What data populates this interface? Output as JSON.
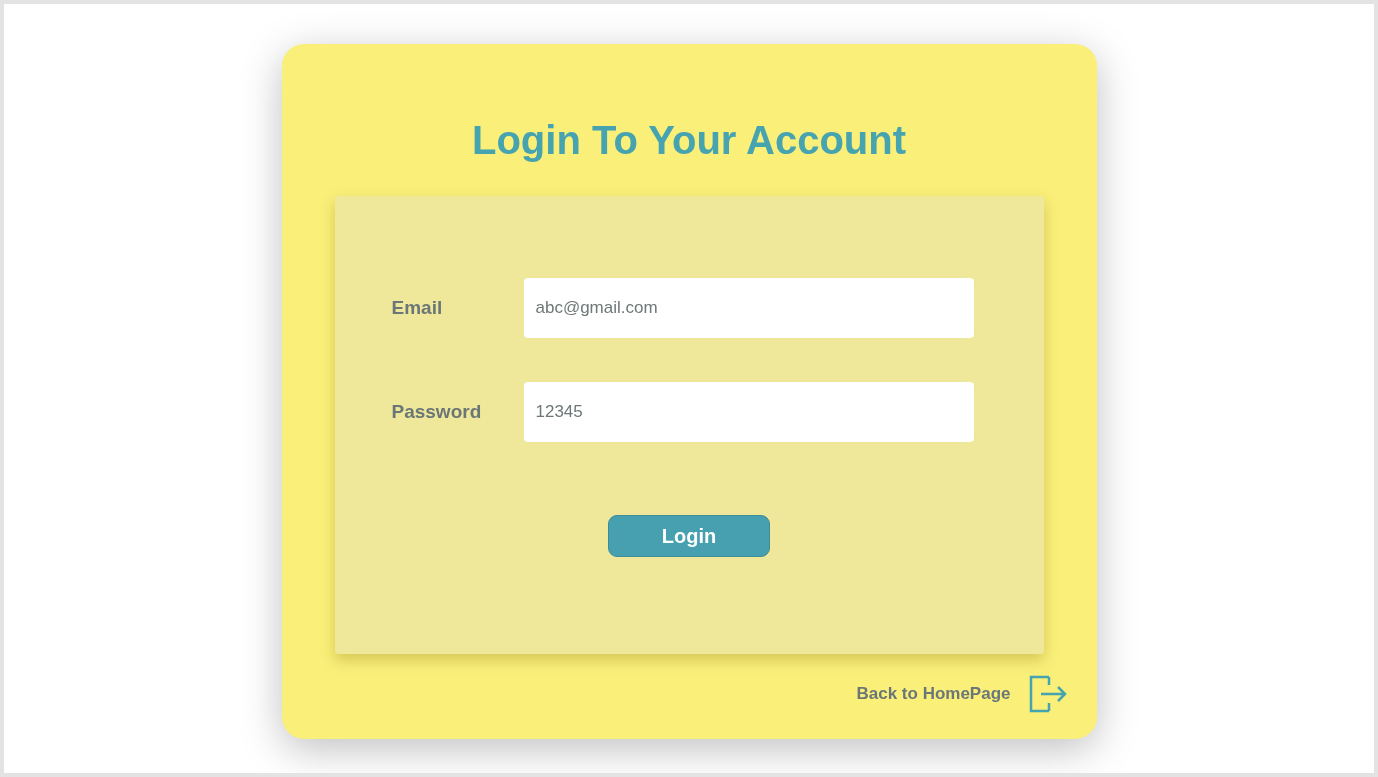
{
  "title": "Login To Your Account",
  "fields": [
    {
      "label": "Email",
      "value": "abc@gmail.com"
    },
    {
      "label": "Password",
      "value": "12345"
    }
  ],
  "login_button": "Login",
  "back_link": "Back to HomePage"
}
